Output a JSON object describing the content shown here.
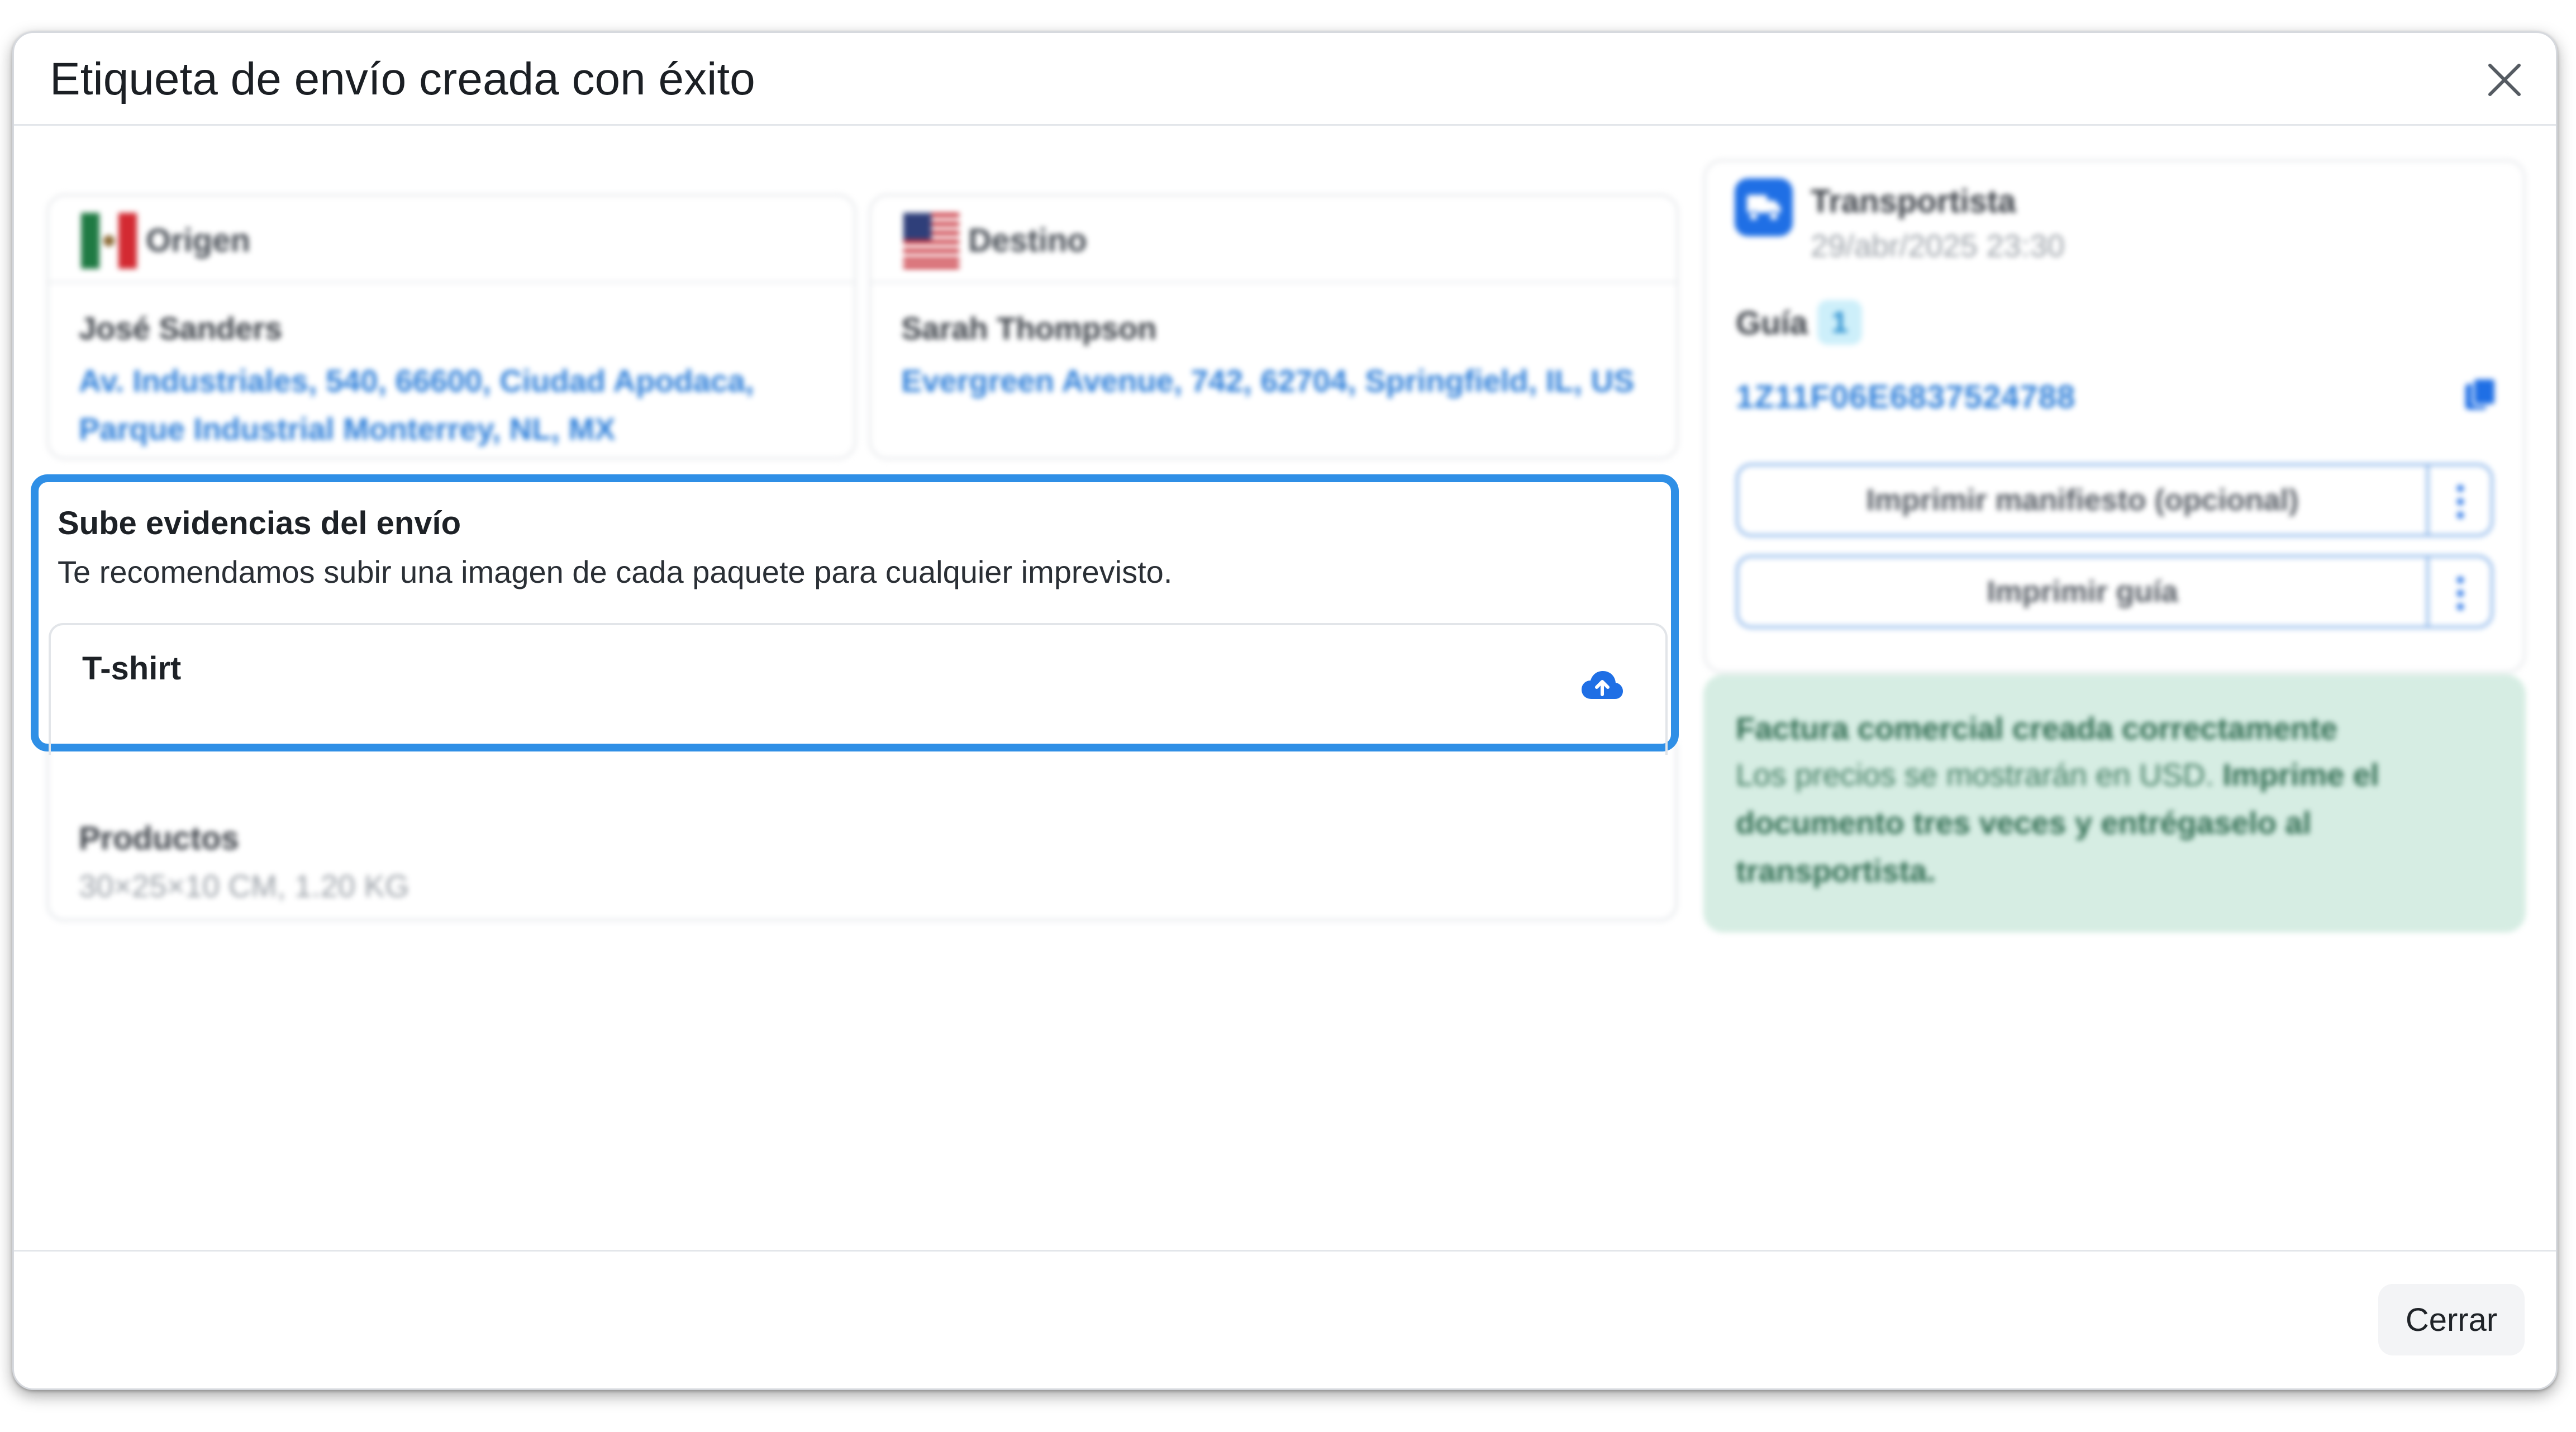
{
  "modal": {
    "title": "Etiqueta de envío creada con éxito"
  },
  "origin": {
    "label": "Origen",
    "name": "José Sanders",
    "address": "Av. Industriales, 540, 66600, Ciudad Apodaca, Parque Industrial Monterrey, NL, MX",
    "flag": "mexico-flag"
  },
  "destination": {
    "label": "Destino",
    "name": "Sarah Thompson",
    "address": "Evergreen Avenue, 742, 62704, Springfield, IL, US",
    "flag": "usa-flag"
  },
  "carrier": {
    "title": "Transportista",
    "date": "29/abr/2025 23:30",
    "guide_label": "Guía",
    "guide_count": "1",
    "tracking_number": "1Z11F06E6837524788",
    "print_manifest_label": "Imprimir manifiesto (opcional)",
    "print_guide_label": "Imprimir guía"
  },
  "invoice": {
    "title": "Factura comercial creada correctamente",
    "text": "Los precios se mostrarán en USD. ",
    "text_bold": "Imprime el documento tres veces y entrégaselo al transportista."
  },
  "upload": {
    "title": "Sube evidencias del envío",
    "description": "Te recomendamos subir una imagen de cada paquete para cualquier imprevisto.",
    "package_name": "T-shirt"
  },
  "products": {
    "label": "Productos",
    "dimensions": "30×25×10 CM, 1.20 KG"
  },
  "footer": {
    "close_label": "Cerrar"
  },
  "colors": {
    "accent": "#2f8fe6",
    "link": "#2e7fd9",
    "success_bg": "#d6ede3"
  }
}
